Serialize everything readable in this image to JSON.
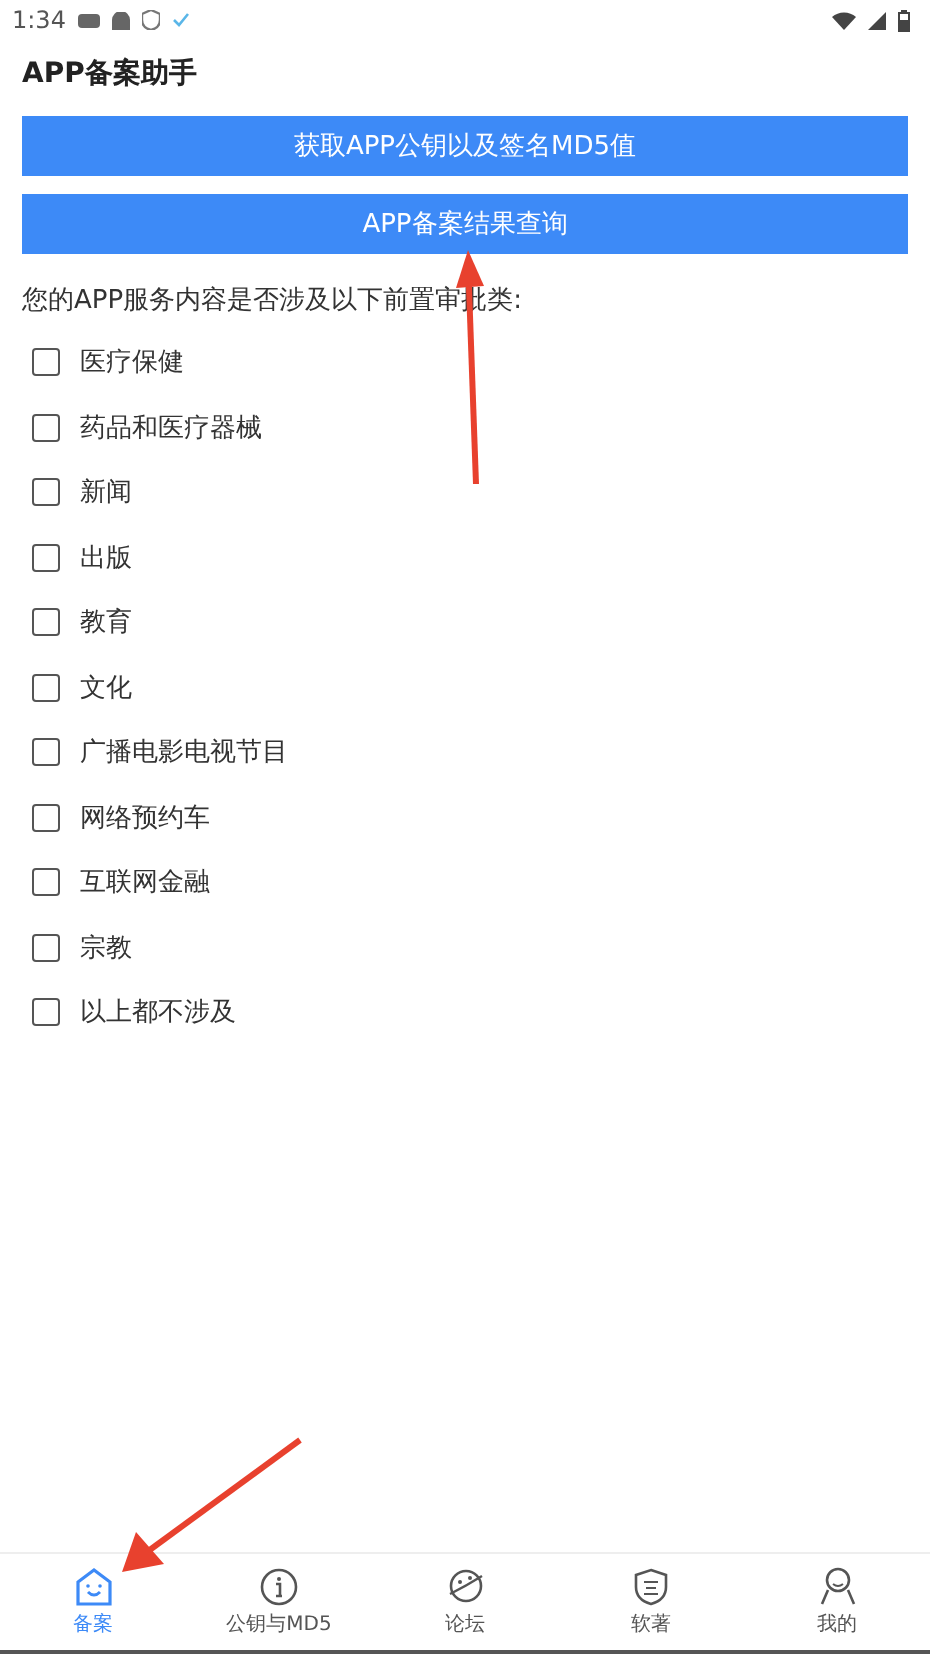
{
  "status_bar": {
    "time": "1:34"
  },
  "title": "APP备案助手",
  "buttons": [
    "获取APP公钥以及签名MD5值",
    "APP备案结果查询"
  ],
  "question": "您的APP服务内容是否涉及以下前置审批类:",
  "options": [
    {
      "label": "医疗保健",
      "checked": false
    },
    {
      "label": "药品和医疗器械",
      "checked": false
    },
    {
      "label": "新闻",
      "checked": false
    },
    {
      "label": "出版",
      "checked": false
    },
    {
      "label": "教育",
      "checked": false
    },
    {
      "label": "文化",
      "checked": false
    },
    {
      "label": "广播电影电视节目",
      "checked": false
    },
    {
      "label": "网络预约车",
      "checked": false
    },
    {
      "label": "互联网金融",
      "checked": false
    },
    {
      "label": "宗教",
      "checked": false
    },
    {
      "label": "以上都不涉及",
      "checked": false
    }
  ],
  "nav": [
    {
      "kind": "home",
      "label": "备案",
      "selected": true
    },
    {
      "kind": "info",
      "label": "公钥与MD5",
      "selected": false
    },
    {
      "kind": "planet",
      "label": "论坛",
      "selected": false
    },
    {
      "kind": "shield",
      "label": "软著",
      "selected": false
    },
    {
      "kind": "person",
      "label": "我的",
      "selected": false
    }
  ]
}
